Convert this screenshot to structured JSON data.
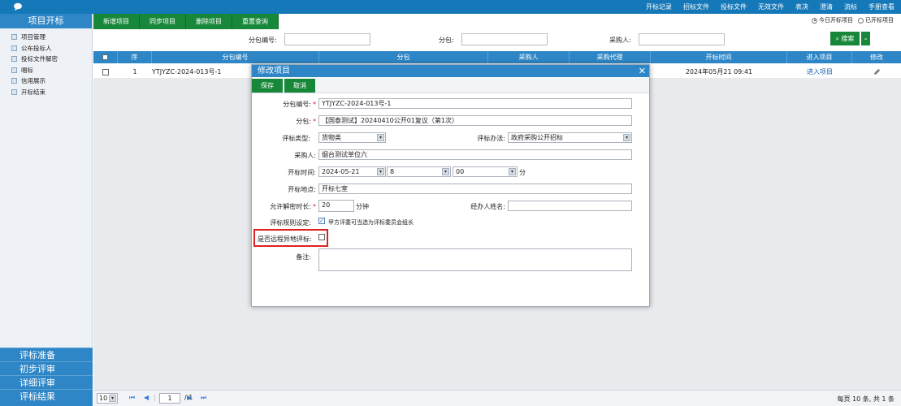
{
  "topnav": [
    "开标记录",
    "招标文件",
    "投标文件",
    "无效文件",
    "表决",
    "澄清",
    "流标",
    "手册查看"
  ],
  "sidebar": {
    "title": "项目开标",
    "items": [
      "项目管理",
      "公布投标人",
      "投标文件解密",
      "唱标",
      "信用展示",
      "开标结束"
    ],
    "footer": [
      "评标准备",
      "初步评审",
      "详细评审",
      "评标结果"
    ]
  },
  "toolbar": [
    "新增项目",
    "同步项目",
    "删除项目",
    "重置查询"
  ],
  "radios": {
    "today": "今日开标项目",
    "opened": "已开标项目"
  },
  "filters": {
    "pkg_no": "分包编号:",
    "pkg": "分包:",
    "purchaser": "采购人:",
    "search": "搜索"
  },
  "table": {
    "headers": [
      "序",
      "分包编号",
      "分包",
      "采购人",
      "采购代理",
      "开标时间",
      "进入项目",
      "修改"
    ],
    "row": {
      "seq": "1",
      "pkg_no": "YTJYZC-2024-013号-1",
      "time": "2024年05月21 09:41",
      "enter": "进入项目"
    }
  },
  "pager": {
    "size": "10",
    "page": "1",
    "total": "/ 1",
    "summary": "每页 10 条, 共 1 条"
  },
  "modal": {
    "title": "修改项目",
    "save": "保存",
    "cancel": "取消",
    "pkg_no_label": "分包编号:",
    "pkg_no": "YTJYZC-2024-013号-1",
    "pkg_label": "分包:",
    "pkg": "【国泰测试】20240410公开01复议（第1次）",
    "eval_type_label": "评标类型:",
    "eval_type": "货物类",
    "eval_method_label": "评标办法:",
    "eval_method": "政府采购公开招标",
    "purchaser_label": "采购人:",
    "purchaser": "烟台测试单位六",
    "open_time_label": "开标时间:",
    "open_date": "2024-05-21",
    "open_hour": "8",
    "open_min": "00",
    "min_unit": "分",
    "place_label": "开标地点:",
    "place": "开标七室",
    "decrypt_label": "允许解密时长:",
    "decrypt": "20",
    "decrypt_unit": "分钟",
    "handler_label": "经办人姓名:",
    "rule_label": "评标规则设定:",
    "rule_text": "甲方评委可当选为评标委员会组长",
    "remote_label": "是否远程异地评标:",
    "remark_label": "备注:"
  }
}
